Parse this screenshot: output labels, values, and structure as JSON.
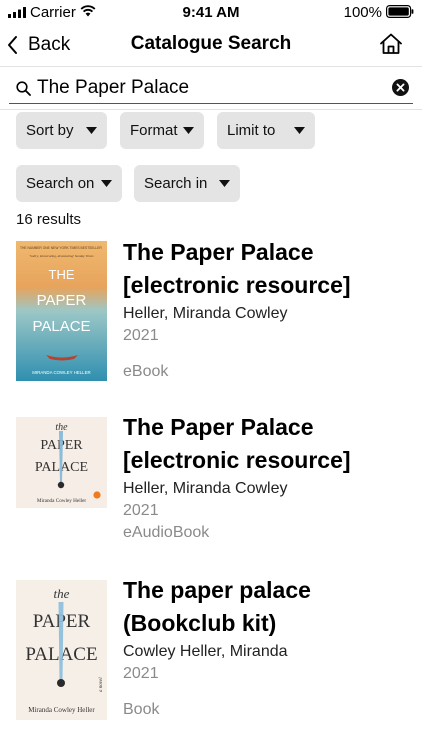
{
  "status_bar": {
    "carrier": "Carrier",
    "time": "9:41 AM",
    "battery": "100%"
  },
  "nav": {
    "back_label": "Back",
    "title": "Catalogue Search",
    "back_icon": "chevron-left-icon",
    "home_icon": "home-icon"
  },
  "search": {
    "value": "The Paper Palace",
    "icon": "search-icon",
    "clear_icon": "clear-icon"
  },
  "filters": [
    {
      "label": "Sort by"
    },
    {
      "label": "Format"
    },
    {
      "label": "Limit to"
    },
    {
      "label": "Search on"
    },
    {
      "label": "Search in"
    }
  ],
  "result_count": "16 results",
  "results": [
    {
      "title": "The Paper Palace [electronic resource]",
      "author": "Heller, Miranda Cowley",
      "year": "2021",
      "format": "eBook",
      "cover": {
        "top_text": "THE NUMBER ONE NEW YORK TIMES BESTSELLER",
        "tagline": "'Sultry, intoxicating, devastating' Sunday Times",
        "title_lines": [
          "THE",
          "PAPER",
          "PALACE"
        ],
        "author": "MIRANDA COWLEY HELLER"
      }
    },
    {
      "title": "The Paper Palace [electronic resource]",
      "author": "Heller, Miranda Cowley",
      "year": "2021",
      "format": "eAudioBook",
      "cover": {
        "title_lines": [
          "the",
          "PAPER",
          "PALACE"
        ],
        "author": "Miranda Cowley Heller"
      }
    },
    {
      "title": "The paper palace (Bookclub kit)",
      "author": "Cowley Heller, Miranda",
      "year": "2021",
      "format": "Book",
      "cover": {
        "title_lines": [
          "the",
          "PAPER",
          "PALACE"
        ],
        "side_text": "a novel",
        "author": "Miranda Cowley Heller"
      }
    }
  ]
}
